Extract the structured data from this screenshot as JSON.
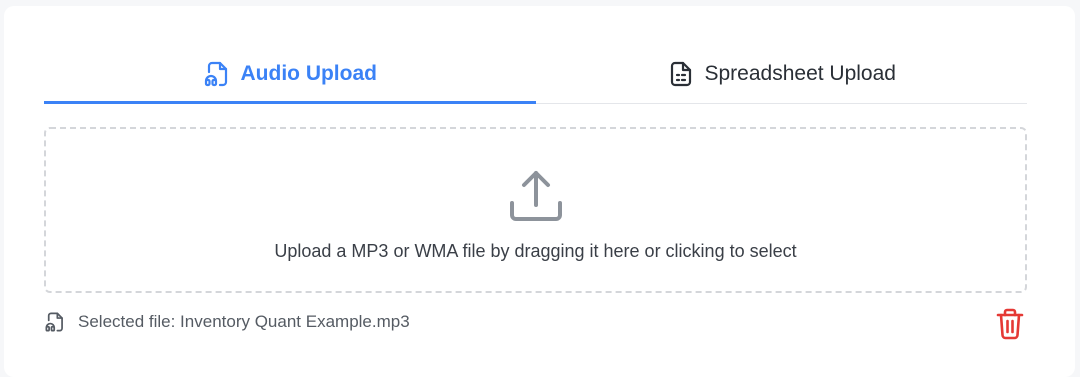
{
  "tabs": [
    {
      "label": "Audio Upload",
      "icon": "audio-file-icon",
      "active": true
    },
    {
      "label": "Spreadsheet Upload",
      "icon": "spreadsheet-file-icon",
      "active": false
    }
  ],
  "dropzone": {
    "icon": "upload-icon",
    "text": "Upload a MP3 or WMA file by dragging it here or clicking to select"
  },
  "selected_file": {
    "icon": "audio-file-icon",
    "text": "Selected file: Inventory Quant Example.mp3"
  },
  "delete_icon": "trash-icon",
  "colors": {
    "accent": "#3b82f6",
    "danger": "#e53935",
    "muted_icon": "#8d939b"
  }
}
